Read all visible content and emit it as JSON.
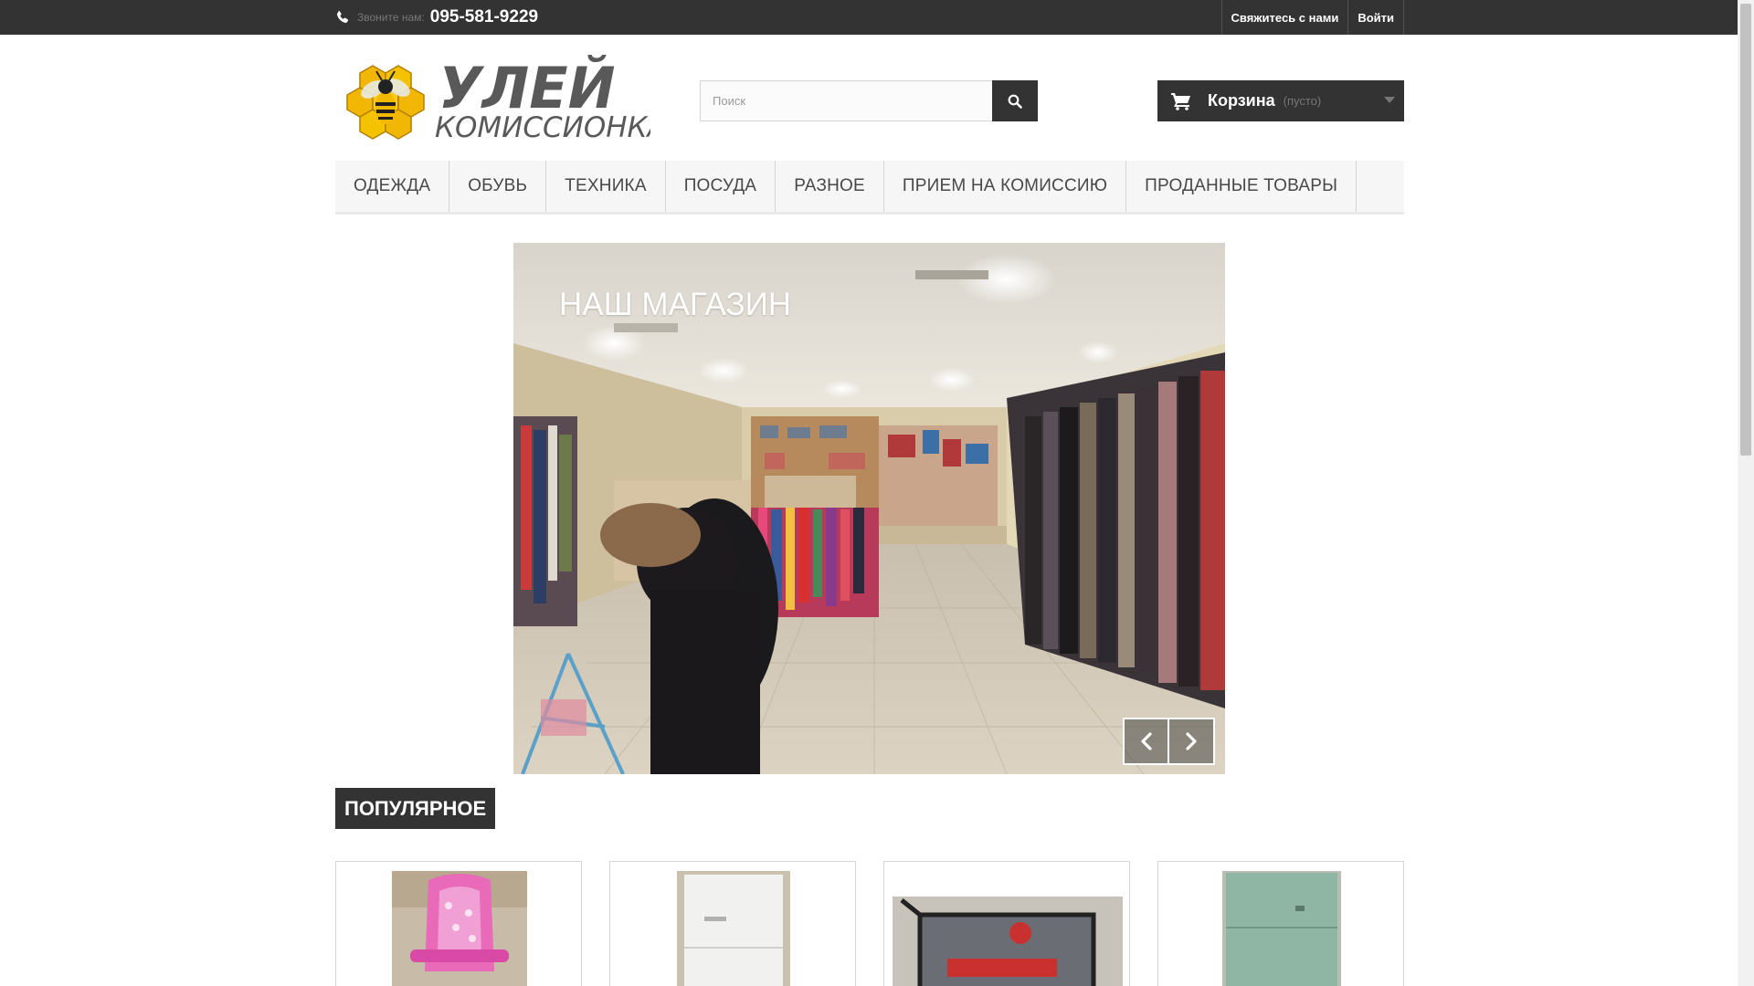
{
  "topbar": {
    "phone_label": "Звоните нам:",
    "phone_number": "095-581-9229",
    "links": [
      "Свяжитесь с нами",
      "Войти"
    ]
  },
  "logo": {
    "line1": "УЛЕЙ",
    "line2": "КОМИССИОНКА"
  },
  "search": {
    "placeholder": "Поиск"
  },
  "cart": {
    "title": "Корзина",
    "status": "(пусто)"
  },
  "menu": {
    "items": [
      "Одежда",
      "Обувь",
      "Техника",
      "Посуда",
      "Разное",
      "Прием на комиссию",
      "Проданные товары"
    ]
  },
  "slider": {
    "caption": "Наш магазин"
  },
  "popular": {
    "title": "Популярное"
  },
  "colors": {
    "dark": "#333333",
    "menu_bg": "#f6f6f6",
    "logo_gray": "#595959",
    "bee_yellow": "#f2b705"
  },
  "icons": [
    "phone-icon",
    "search-icon",
    "cart-icon",
    "chevron-left-icon",
    "chevron-right-icon"
  ]
}
